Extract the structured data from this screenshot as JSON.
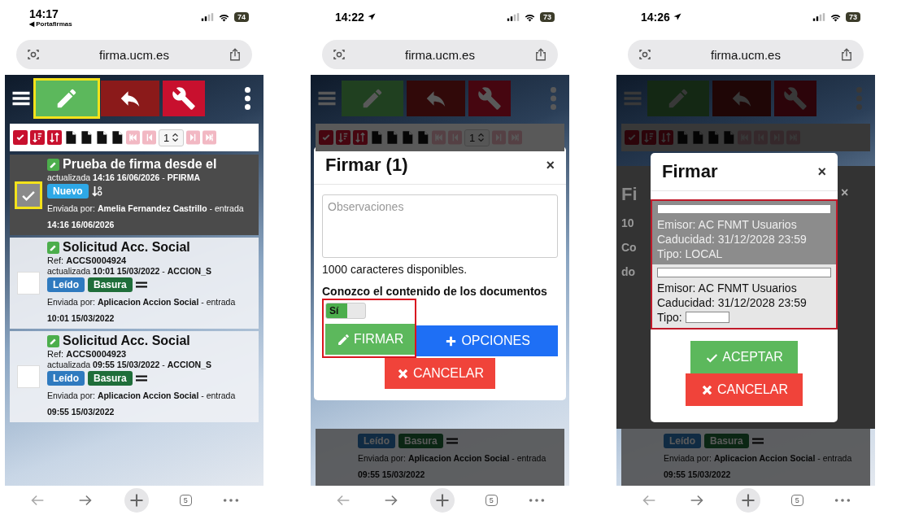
{
  "screens": [
    {
      "kind": "list",
      "status": {
        "time": "14:17",
        "back_label": "◀ Portafirmas",
        "location": false,
        "battery": "74"
      },
      "address": "firma.ucm.es",
      "tabs": "5",
      "toolbar": [
        {
          "kind": "menu",
          "highlighted": false
        },
        {
          "kind": "sign",
          "highlighted": true
        },
        {
          "kind": "reply",
          "highlighted": false
        },
        {
          "kind": "settings",
          "highlighted": false
        },
        {
          "kind": "more",
          "highlighted": false
        }
      ],
      "page": "1",
      "items": [
        {
          "checked": true,
          "highlighted": true,
          "title": "Prueba de firma desde el",
          "updated": "actualizada **14:16 16/06/2026** -  **PFIRMA**",
          "badges": [
            {
              "label": "Nuevo",
              "kind": "new"
            }
          ],
          "priority": {
            "kind": "low"
          },
          "sender": "Enviada por: **Amelia Fernandez Castrillo** - entrada **14:16 16/06/2026**"
        },
        {
          "checked": false,
          "highlighted": false,
          "title": "Solicitud Acc. Social",
          "ref": "Ref: **ACCS0004924**",
          "updated": "actualizada **10:01 15/03/2022** -  **ACCION_S**",
          "badges": [
            {
              "label": "Leído",
              "kind": "read"
            },
            {
              "label": "Basura",
              "kind": "trash"
            }
          ],
          "priority": {
            "kind": "normal"
          },
          "sender": "Enviada por: **Aplicacion Accion Social** - entrada **10:01 15/03/2022**"
        },
        {
          "checked": false,
          "highlighted": false,
          "title": "Solicitud Acc. Social",
          "ref": "Ref: **ACCS0004923**",
          "updated": "actualizada **09:55 15/03/2022** -  **ACCION_S**",
          "badges": [
            {
              "label": "Leído",
              "kind": "read"
            },
            {
              "label": "Basura",
              "kind": "trash"
            }
          ],
          "priority": {
            "kind": "normal"
          },
          "sender": "Enviada por: **Aplicacion Accion Social** - entrada **09:55 15/03/2022**"
        }
      ]
    },
    {
      "kind": "sign_dialog",
      "status": {
        "time": "14:22",
        "location": true,
        "battery": "73"
      },
      "address": "firma.ucm.es",
      "tabs": "5",
      "toolbar": [
        {
          "kind": "menu",
          "highlighted": false
        },
        {
          "kind": "sign",
          "highlighted": false
        },
        {
          "kind": "reply",
          "highlighted": false
        },
        {
          "kind": "settings",
          "highlighted": false
        },
        {
          "kind": "more",
          "highlighted": false
        }
      ],
      "page": "1",
      "dialog": {
        "title": "Firmar (1)",
        "close": "×",
        "placeholder": "Observaciones",
        "counter": "1000 caracteres disponibles.",
        "label": "Conozco el contenido de los documentos",
        "toggle": {
          "label": "Sí",
          "on": true
        },
        "highlighted": true,
        "buttons": [
          {
            "label": "FIRMAR",
            "kind": "sign"
          },
          {
            "label": "OPCIONES",
            "kind": "options"
          },
          {
            "label": "CANCELAR",
            "kind": "cancel"
          }
        ]
      },
      "behind": {
        "badges": [
          {
            "label": "Leído",
            "kind": "read"
          },
          {
            "label": "Basura",
            "kind": "trash"
          }
        ],
        "priority": {
          "kind": "normal"
        },
        "sender": "Enviada por: **Aplicacion Accion Social** - entrada **09:55 15/03/2022**"
      }
    },
    {
      "kind": "cert_dialog",
      "status": {
        "time": "14:26",
        "location": true,
        "battery": "73"
      },
      "address": "firma.ucm.es",
      "tabs": "5",
      "toolbar": [
        {
          "kind": "menu",
          "highlighted": false
        },
        {
          "kind": "sign",
          "highlighted": false
        },
        {
          "kind": "reply",
          "highlighted": false
        },
        {
          "kind": "settings",
          "highlighted": false
        },
        {
          "kind": "more",
          "highlighted": false
        }
      ],
      "back_dialog": {
        "title": "Fi",
        "close": "×",
        "texts": [
          "10",
          "Co",
          "do"
        ]
      },
      "dialog": {
        "title": "Firmar",
        "close": "×",
        "highlighted": true,
        "certificates": [
          {
            "selected": true,
            "issuer": "Emisor: AC FNMT Usuarios",
            "expiry": "Caducidad: 31/12/2028 23:59",
            "type_label": "Tipo:",
            "type": "LOCAL"
          },
          {
            "selected": false,
            "issuer": "Emisor: AC FNMT Usuarios",
            "expiry": "Caducidad: 31/12/2028 23:59",
            "type_label": "Tipo:"
          }
        ],
        "buttons": [
          {
            "label": "ACEPTAR",
            "kind": "accept"
          },
          {
            "label": "CANCELAR",
            "kind": "cancel"
          }
        ]
      },
      "behind": {
        "badges": [
          {
            "label": "Leído",
            "kind": "read"
          },
          {
            "label": "Basura",
            "kind": "trash"
          }
        ],
        "priority": {
          "kind": "normal"
        },
        "sender": "Enviada por: **Aplicacion Accion Social** - entrada **09:55 15/03/2022**"
      }
    }
  ]
}
